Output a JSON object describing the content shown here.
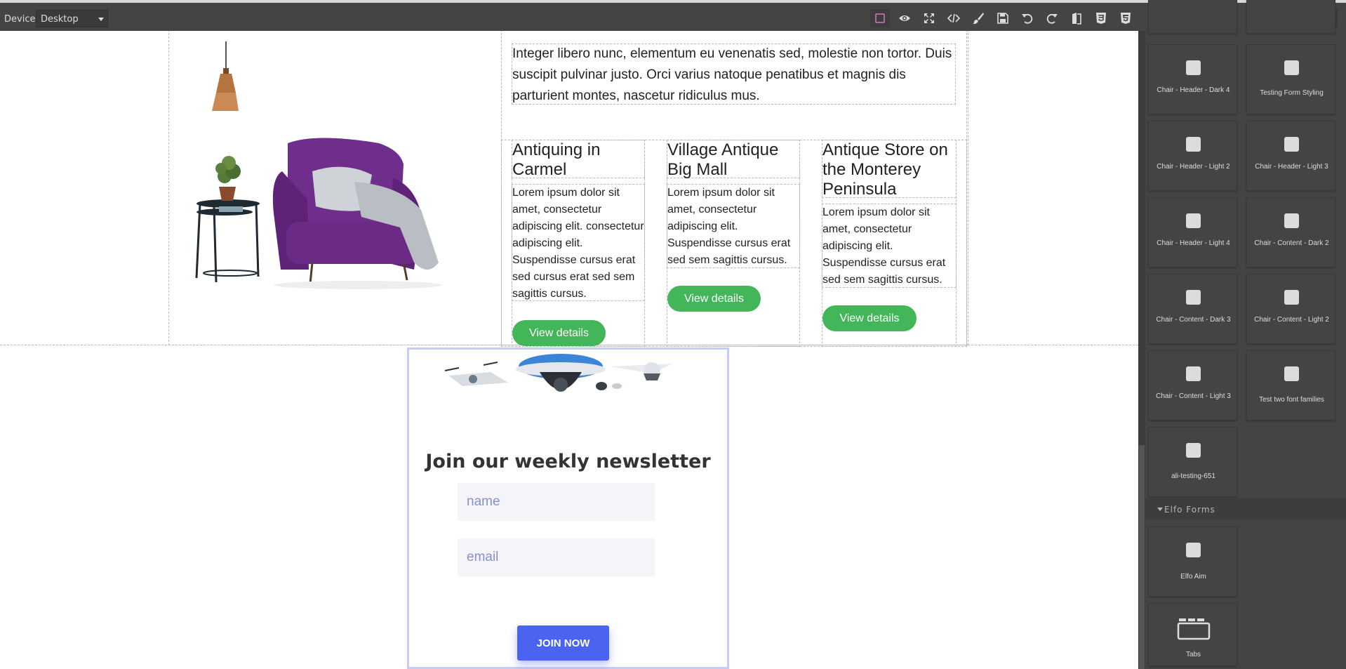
{
  "toolbar": {
    "device_label": "Device",
    "device_value": "Desktop",
    "icons": [
      "sw-visibility-icon",
      "preview-eye-icon",
      "fullscreen-icon",
      "code-icon",
      "brush-icon",
      "save-icon",
      "undo-icon",
      "redo-icon",
      "import-icon",
      "css-icon",
      "html-icon"
    ],
    "panel_tabs": [
      "style-manager-brush-icon",
      "settings-gear-icon",
      "layers-icon",
      "blocks-grid-icon"
    ],
    "accent_color": "#d278c9"
  },
  "content": {
    "intro": "Integer libero nunc, elementum eu venenatis sed, molestie non tortor. Duis suscipit pulvinar justo. Orci varius natoque penatibus et magnis dis parturient montes, nascetur ridiculus mus.",
    "cards": [
      {
        "title": "Antiquing in Carmel",
        "body": "Lorem ipsum dolor sit amet, consectetur adipiscing elit. consectetur adipiscing elit. Suspendisse cursus erat sed cursus erat sed sem sagittis cursus.",
        "button": "View details"
      },
      {
        "title": "Village Antique Big Mall",
        "body": "Lorem ipsum dolor sit amet, consectetur adipiscing elit. Suspendisse cursus erat sed sem sagittis cursus.",
        "button": "View details"
      },
      {
        "title": "Antique Store on the Monterey Peninsula",
        "body": "Lorem ipsum dolor sit amet, consectetur adipiscing elit. Suspendisse cursus erat sed sem sagittis cursus.",
        "button": "View details"
      }
    ]
  },
  "newsletter": {
    "title": "Join our weekly newsletter",
    "name_placeholder": "name",
    "email_placeholder": "email",
    "button": "JOIN NOW"
  },
  "blocks": {
    "items": [
      "Chair - Header - Dark 4",
      "Testing Form Styling",
      "Chair - Header - Light 2",
      "Chair - Header - Light 3",
      "Chair - Header - Light 4",
      "Chair - Content - Dark 2",
      "Chair - Content - Dark 3",
      "Chair - Content - Light 2",
      "Chair - Content - Light 3",
      "Test two font families",
      "ali-testing-651"
    ],
    "section": "Elfo Forms",
    "section_items": [
      "Elfo Aim",
      "Tabs"
    ]
  }
}
